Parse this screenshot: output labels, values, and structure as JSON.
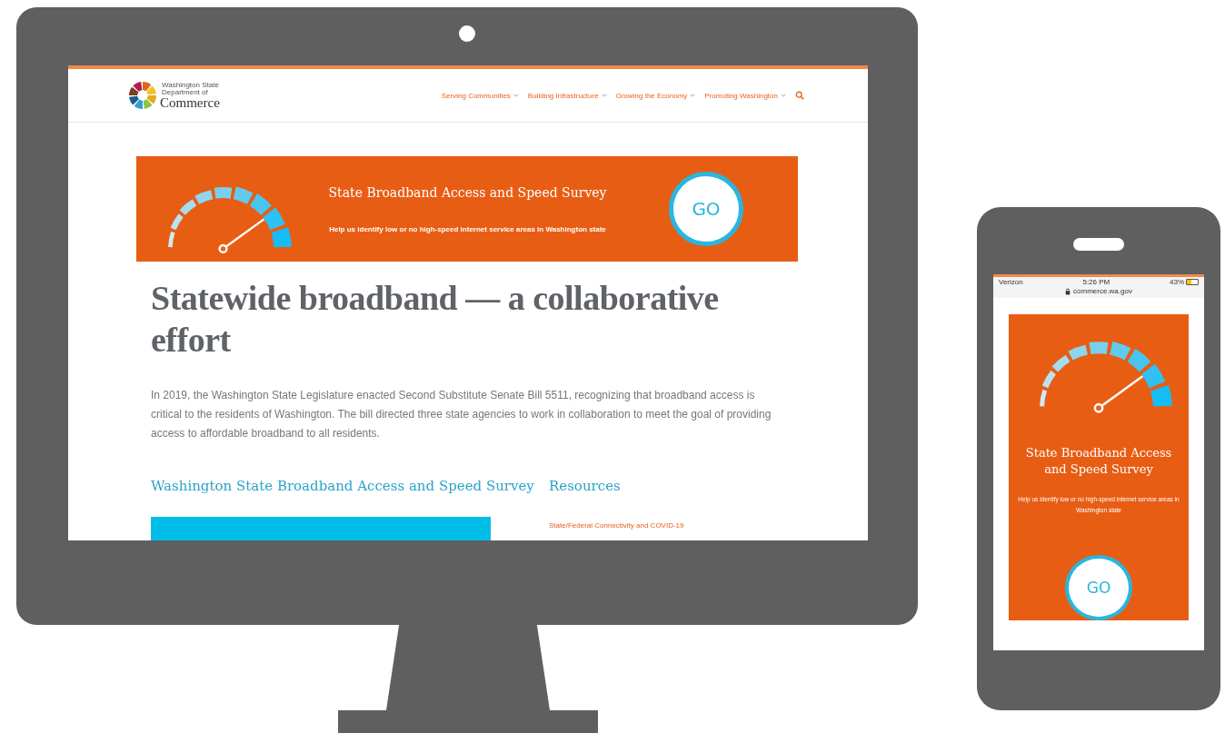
{
  "desktop": {
    "header": {
      "logo_lines": [
        "Washington State",
        "Department of",
        "Commerce"
      ],
      "nav": [
        {
          "label": "Serving Communities"
        },
        {
          "label": "Building Infrastructure"
        },
        {
          "label": "Growing the Economy"
        },
        {
          "label": "Promoting Washington"
        }
      ]
    },
    "banner": {
      "title": "State Broadband Access and Speed Survey",
      "subtitle": "Help us identify low or no high-speed internet service areas in Washington state",
      "button": "GO"
    },
    "heading": "Statewide broadband — a collaborative effort",
    "paragraph": "In 2019, the Washington State Legislature enacted Second Substitute Senate Bill 5511, recognizing that broadband access is critical to the residents of Washington. The bill directed three state agencies to work in collaboration to meet the goal of providing access to affordable broadband to all residents.",
    "survey_heading": "Washington State Broadband Access and Speed Survey",
    "resources_heading": "Resources",
    "resources": [
      "State/Federal Connectivity and COVID-19"
    ]
  },
  "phone": {
    "status": {
      "carrier": "Verizon",
      "time": "5:26 PM",
      "battery": "43%"
    },
    "url": "commerce.wa.gov",
    "banner": {
      "title": "State Broadband Access and Speed Survey",
      "subtitle": "Help us identify low or no high-speed internet service areas in Washington state",
      "button": "GO"
    }
  }
}
